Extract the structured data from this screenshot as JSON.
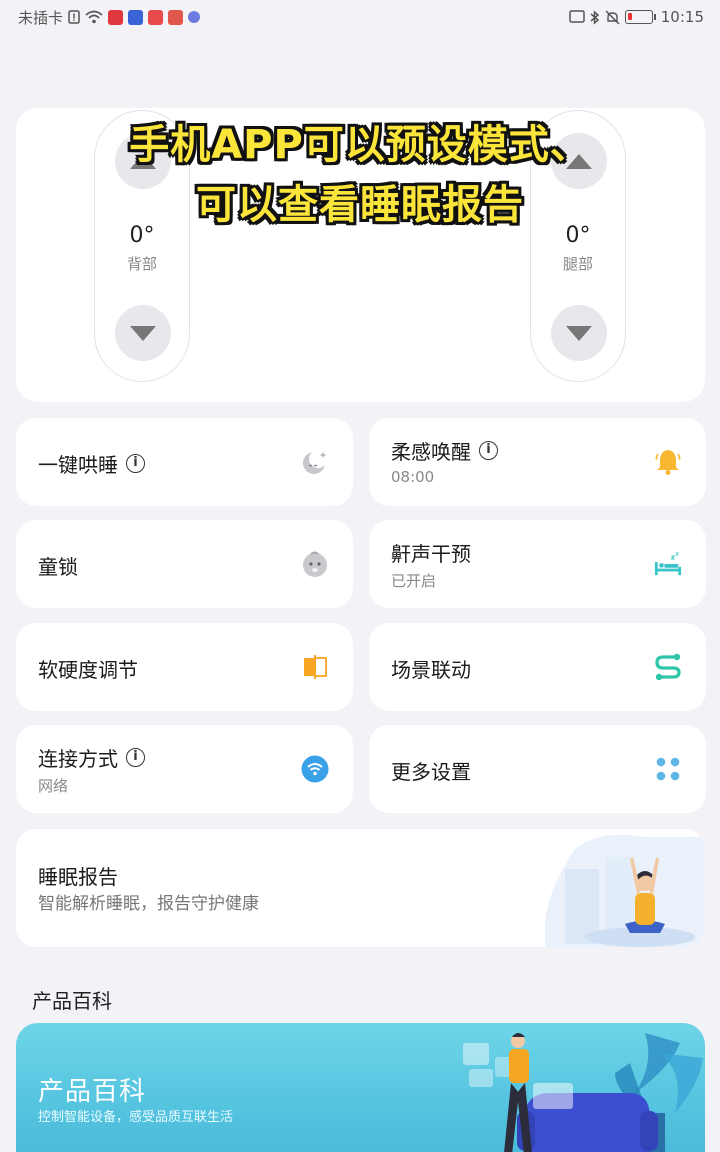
{
  "status_bar": {
    "carrier": "未插卡",
    "time": "10:15"
  },
  "overlay_caption": {
    "line1": "手机APP可以预设模式、",
    "line2": "可以查看睡眠报告"
  },
  "controls": {
    "back": {
      "angle": "0°",
      "label": "背部"
    },
    "leg": {
      "angle": "0°",
      "label": "腿部"
    }
  },
  "tiles": {
    "one_key_sleep": {
      "title": "一键哄睡",
      "icon": "moon-sleep-icon"
    },
    "gentle_wake": {
      "title": "柔感唤醒",
      "subtitle": "08:00",
      "icon": "bell-icon",
      "icon_color": "#f7b731"
    },
    "child_lock": {
      "title": "童锁",
      "icon": "baby-face-icon"
    },
    "snore_intervention": {
      "title": "鼾声干预",
      "subtitle": "已开启",
      "icon": "sleeping-bed-icon",
      "icon_color": "#38c4c9"
    },
    "firmness": {
      "title": "软硬度调节",
      "icon": "firmness-icon",
      "icon_color": "#f7a623"
    },
    "scene_link": {
      "title": "场景联动",
      "icon": "scene-link-icon",
      "icon_color": "#2ec6a9"
    },
    "connection": {
      "title": "连接方式",
      "subtitle": "网络",
      "icon": "wifi-icon",
      "icon_color": "#3aa0e8"
    },
    "more_settings": {
      "title": "更多设置",
      "icon": "grid-dots-icon",
      "icon_color": "#5eb6e4"
    }
  },
  "sleep_report": {
    "title": "睡眠报告",
    "subtitle": "智能解析睡眠，报告守护健康"
  },
  "encyclopedia": {
    "section_title": "产品百科",
    "banner_title": "产品百科",
    "banner_subtitle": "控制智能设备，感受品质互联生活"
  }
}
